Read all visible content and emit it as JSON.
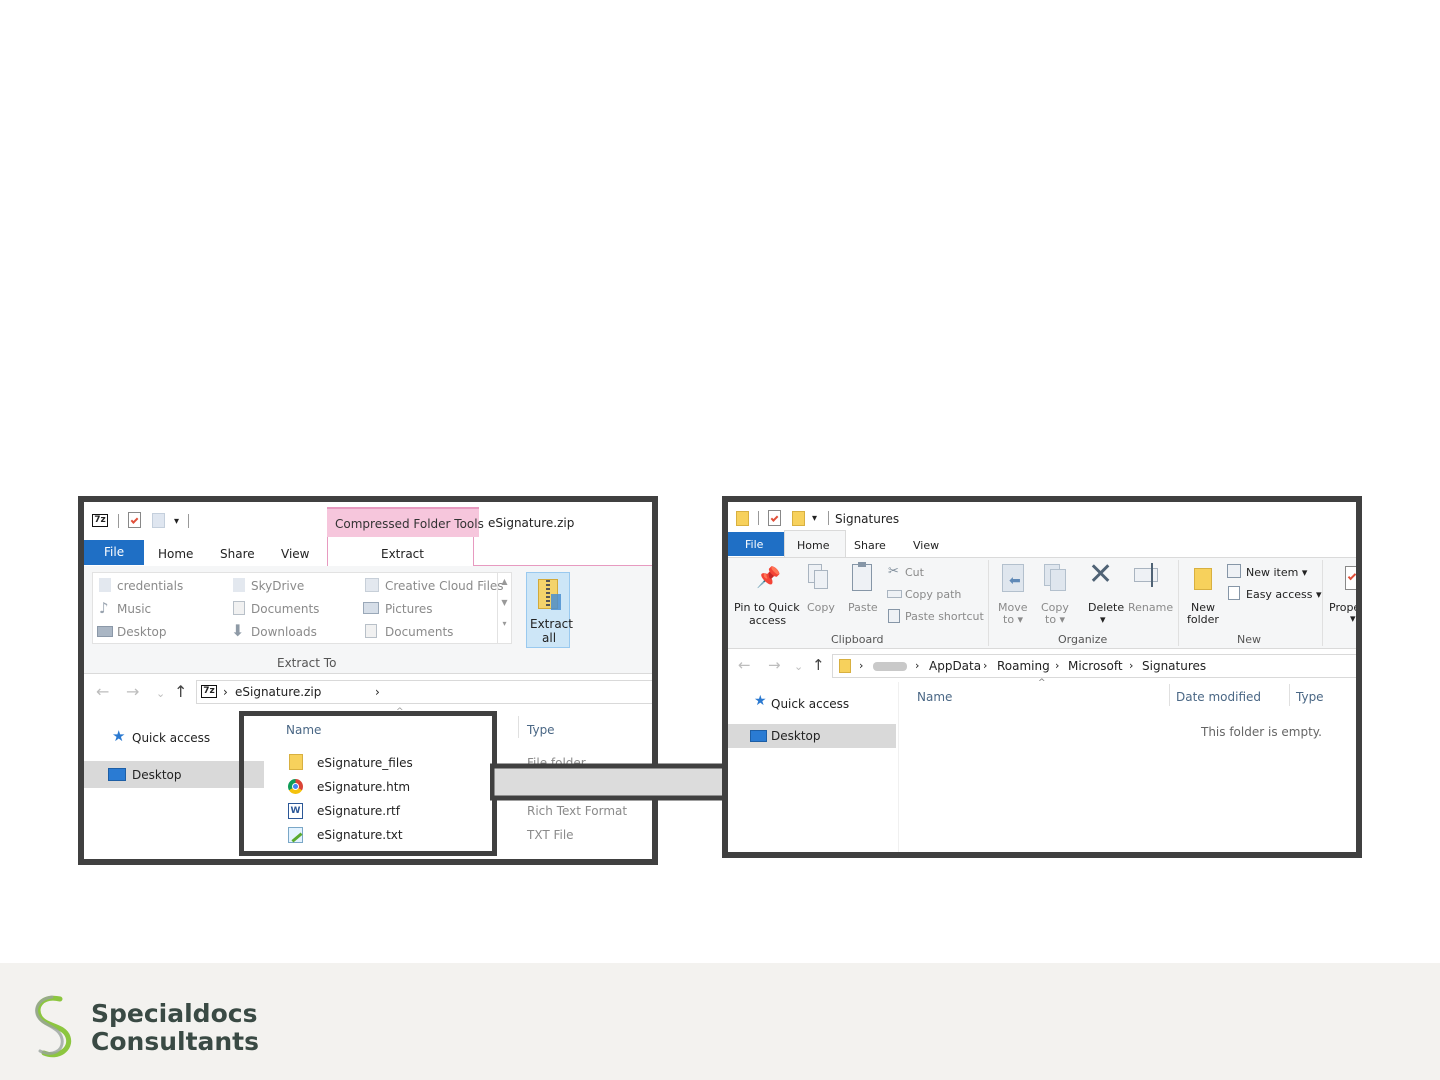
{
  "left_window": {
    "title": "eSignature.zip",
    "contextual_tab_group": "Compressed Folder Tools",
    "tabs": [
      "File",
      "Home",
      "Share",
      "View",
      "Extract"
    ],
    "extract_to_items": [
      {
        "label": "credentials",
        "icon": "folder-icon"
      },
      {
        "label": "SkyDrive",
        "icon": "folder-icon"
      },
      {
        "label": "Creative Cloud Files",
        "icon": "cloud-folder-icon"
      },
      {
        "label": "Music",
        "icon": "music-icon"
      },
      {
        "label": "Documents",
        "icon": "documents-icon"
      },
      {
        "label": "Pictures",
        "icon": "pictures-icon"
      },
      {
        "label": "Desktop",
        "icon": "desktop-icon"
      },
      {
        "label": "Downloads",
        "icon": "download-icon"
      },
      {
        "label": "Documents",
        "icon": "documents-icon"
      }
    ],
    "extract_to_group": "Extract To",
    "extract_all": {
      "line1": "Extract",
      "line2": "all"
    },
    "address": {
      "app_badge": "7z",
      "path": "eSignature.zip"
    },
    "nav": {
      "quick_access": "Quick access",
      "desktop": "Desktop"
    },
    "columns": {
      "name": "Name",
      "type": "Type"
    },
    "files": [
      {
        "name": "eSignature_files",
        "type": "File folder",
        "icon": "folder-icon"
      },
      {
        "name": "eSignature.htm",
        "type": "",
        "icon": "chrome-icon"
      },
      {
        "name": "eSignature.rtf",
        "type": "Rich Text Format",
        "icon": "word-icon"
      },
      {
        "name": "eSignature.txt",
        "type": "TXT File",
        "icon": "notepad-icon"
      }
    ]
  },
  "right_window": {
    "title": "Signatures",
    "tabs": [
      "File",
      "Home",
      "Share",
      "View"
    ],
    "clipboard": {
      "pin": {
        "line1": "Pin to Quick",
        "line2": "access"
      },
      "copy": "Copy",
      "paste": "Paste",
      "cut": "Cut",
      "copy_path": "Copy path",
      "paste_shortcut": "Paste shortcut",
      "group": "Clipboard"
    },
    "organize": {
      "move_to": {
        "line1": "Move",
        "line2": "to ▾"
      },
      "copy_to": {
        "line1": "Copy",
        "line2": "to ▾"
      },
      "delete": {
        "line1": "Delete",
        "line2": "▾"
      },
      "rename": "Rename",
      "group": "Organize"
    },
    "new": {
      "new_folder": {
        "line1": "New",
        "line2": "folder"
      },
      "new_item": "New item ▾",
      "easy_access": "Easy access ▾",
      "group": "New"
    },
    "open_partial": "Prope",
    "breadcrumb": [
      "AppData",
      "Roaming",
      "Microsoft",
      "Signatures"
    ],
    "nav": {
      "quick_access": "Quick access",
      "desktop": "Desktop"
    },
    "columns": {
      "name": "Name",
      "date_modified": "Date modified",
      "type": "Type"
    },
    "empty_message": "This folder is empty."
  },
  "brand": {
    "line1": "Specialdocs",
    "line2": "Consultants",
    "color_dark": "#3a4a44",
    "color_green": "#8cc63f",
    "color_grey": "#9aa29e"
  },
  "colors": {
    "file_tab": "#1f6fc5",
    "contextual_pink": "#f6c6dc",
    "frame": "#404040",
    "arrow_fill": "#dcdcdc"
  }
}
